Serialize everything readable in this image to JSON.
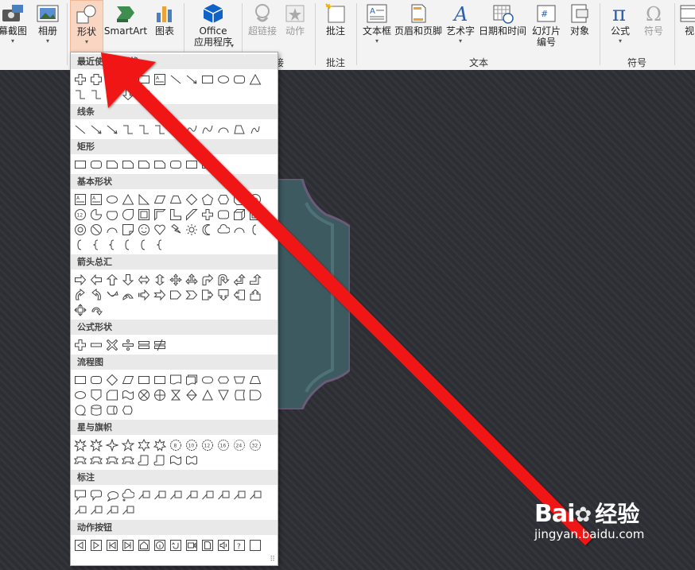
{
  "ribbon": {
    "buttons": [
      {
        "label": "幕截图",
        "icon": "screenshot-icon",
        "caret": true
      },
      {
        "label": "相册",
        "icon": "photo-album-icon",
        "caret": true
      },
      {
        "label": "形状",
        "icon": "shapes-icon",
        "caret": true,
        "active": true
      },
      {
        "label": "SmartArt",
        "icon": "smartart-icon",
        "caret": false
      },
      {
        "label": "图表",
        "icon": "chart-icon",
        "caret": false
      },
      {
        "label": "Office\n应用程序",
        "line1": "Office",
        "line2": "应用程序",
        "icon": "office-addins-icon",
        "caret": true
      },
      {
        "label": "超链接",
        "icon": "hyperlink-icon",
        "disabled": true
      },
      {
        "label": "动作",
        "icon": "action-icon",
        "disabled": true
      },
      {
        "label": "批注",
        "icon": "comment-icon"
      },
      {
        "label": "文本框",
        "icon": "textbox-icon",
        "caret": true
      },
      {
        "label": "页眉和页脚",
        "icon": "header-footer-icon"
      },
      {
        "label": "艺术字",
        "icon": "wordart-icon",
        "caret": true
      },
      {
        "label": "日期和时间",
        "icon": "date-time-icon"
      },
      {
        "line1": "幻灯片",
        "line2": "编号",
        "icon": "slide-number-icon"
      },
      {
        "label": "对象",
        "icon": "object-icon"
      },
      {
        "label": "公式",
        "icon": "equation-icon",
        "caret": true
      },
      {
        "label": "符号",
        "icon": "symbol-icon",
        "disabled": true
      },
      {
        "label": "视",
        "icon": "video-icon"
      }
    ],
    "groups": {
      "links": "接",
      "comments": "批注",
      "text": "文本",
      "symbols": "符号"
    }
  },
  "panel": {
    "sections": [
      {
        "title": "最近使用的形状"
      },
      {
        "title": "线条"
      },
      {
        "title": "矩形"
      },
      {
        "title": "基本形状"
      },
      {
        "title": "箭头总汇"
      },
      {
        "title": "公式形状"
      },
      {
        "title": "流程图"
      },
      {
        "title": "星与旗帜"
      },
      {
        "title": "标注"
      },
      {
        "title": "动作按钮"
      }
    ]
  },
  "watermark": {
    "logo_left": "Bai",
    "logo_right": "经验",
    "url": "jingyan.baidu.com"
  },
  "colors": {
    "arrow": "#f01414",
    "ribbon_bg": "#f3f3f3",
    "active_button": "#f9d6c2",
    "section_header": "#e9e9e9",
    "slide_bg": "#2f3035",
    "shape_fill": "#3d5a60"
  }
}
